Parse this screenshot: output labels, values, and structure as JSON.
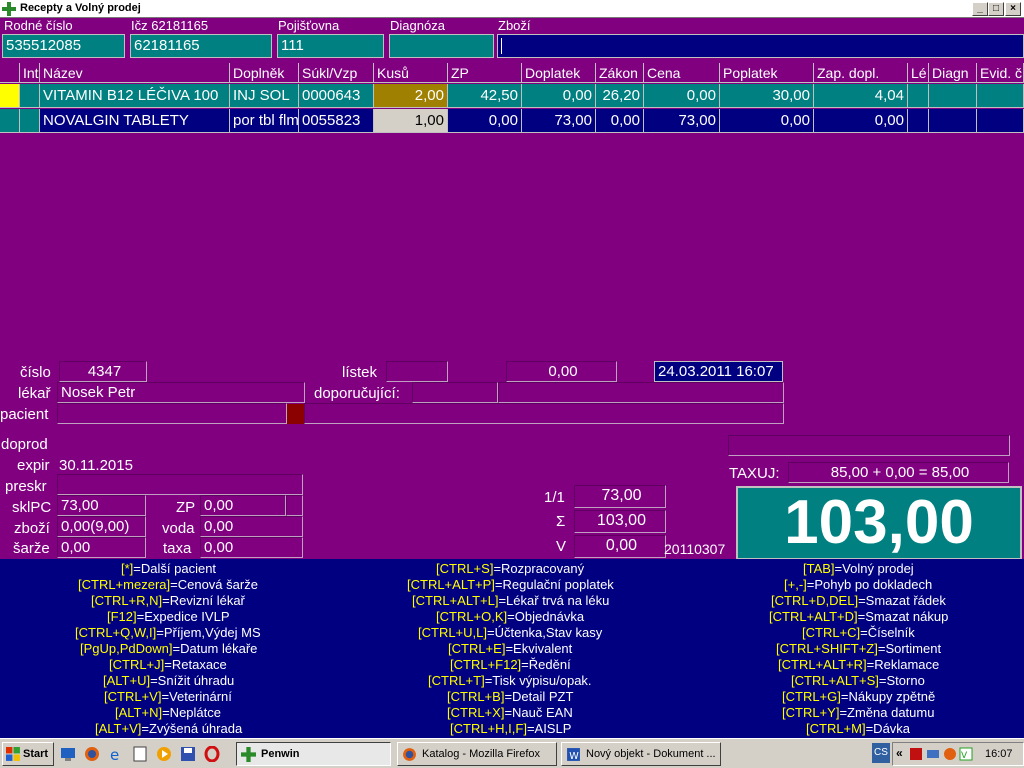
{
  "window": {
    "title": "Recepty a Volný prodej",
    "min": "_",
    "max": "□",
    "close": "×"
  },
  "header": {
    "rodne_cislo": {
      "label": "Rodné číslo",
      "value": "535512085"
    },
    "icz": {
      "label": "Ičz 62181165",
      "value": "62181165"
    },
    "pojistovna": {
      "label": "Pojišťovna",
      "value": "111"
    },
    "diagnoza": {
      "label": "Diagnóza",
      "value": ""
    },
    "zbozi": {
      "label": "Zboží",
      "value": ""
    }
  },
  "grid": {
    "columns": [
      "",
      "Int",
      "Název",
      "Doplněk",
      "Súkl/Vzp",
      "Kusů",
      "ZP",
      "Doplatek",
      "Zákon",
      "Cena",
      "Poplatek",
      "Zap. dopl.",
      "Lé",
      "Diagn",
      "Evid. č"
    ],
    "rows": [
      {
        "nazev": "VITAMIN B12 LÉČIVA 100",
        "doplnek": "INJ SOL",
        "sukl": "0000643",
        "kusu": "2,00",
        "zp": "42,50",
        "doplatek": "0,00",
        "zakon": "26,20",
        "cena": "0,00",
        "poplatek": "30,00",
        "zap": "4,04"
      },
      {
        "nazev": "NOVALGIN TABLETY",
        "doplnek": "por tbl flm",
        "sukl": "0055823",
        "kusu": "1,00",
        "zp": "0,00",
        "doplatek": "73,00",
        "zakon": "0,00",
        "cena": "73,00",
        "poplatek": "0,00",
        "zap": "0,00"
      }
    ]
  },
  "detail": {
    "cislo_label": "číslo",
    "cislo": "4347",
    "listek_label": "lístek",
    "listek": "",
    "amount": "0,00",
    "datetime": "24.03.2011 16:07",
    "lekar_label": "lékař",
    "lekar": "Nosek Petr",
    "doporucujici_label": "doporučující:",
    "pacient_label": "pacient",
    "doprod_label": "doprod",
    "expir_label": "expir",
    "expir": "30.11.2015",
    "preskr_label": "preskr",
    "sklpc_label": "sklPC",
    "sklpc": "73,00",
    "zp_label": "ZP",
    "zp": "0,00",
    "zbozi_label": "zboží",
    "zbozi": "0,00(9,00)",
    "voda_label": "voda",
    "voda": "0,00",
    "sarze_label": "šarže",
    "sarze": "0,00",
    "taxa_label": "taxa",
    "taxa": "0,00",
    "taxuj_label": "TAXUJ:",
    "taxuj": "85,00 + 0,00 = 85,00",
    "page_label": "1/1",
    "page_value": "73,00",
    "sum_label": "Σ",
    "sum_value": "103,00",
    "v_label": "V",
    "v_value": "0,00",
    "doc_no": "20110307",
    "total": "103,00"
  },
  "shortcuts": [
    {
      "key": "[*]",
      "text": "=Další pacient"
    },
    {
      "key": "[CTRL+mezera]",
      "text": "=Cenová šarže"
    },
    {
      "key": "[CTRL+R,N]",
      "text": "=Revizní lékař"
    },
    {
      "key": "[F12]",
      "text": "=Expedice IVLP"
    },
    {
      "key": "[CTRL+Q,W,I]",
      "text": "=Příjem,Výdej MS"
    },
    {
      "key": "[PgUp,PdDown]",
      "text": "=Datum lékaře"
    },
    {
      "key": "[CTRL+J]",
      "text": "=Retaxace"
    },
    {
      "key": "[ALT+U]",
      "text": "=Snížit úhradu"
    },
    {
      "key": "[CTRL+V]",
      "text": "=Veterinární"
    },
    {
      "key": "[ALT+N]",
      "text": "=Neplátce"
    },
    {
      "key": "[ALT+V]",
      "text": "=Zvýšená úhrada"
    },
    {
      "key": "[CTRL+S]",
      "text": "=Rozpracovaný"
    },
    {
      "key": "[CTRL+ALT+P]",
      "text": "=Regulační poplatek"
    },
    {
      "key": "[CTRL+ALT+L]",
      "text": "=Lékař trvá na léku"
    },
    {
      "key": "[CTRL+O,K]",
      "text": "=Objednávka"
    },
    {
      "key": "[CTRL+U,L]",
      "text": "=Účtenka,Stav kasy"
    },
    {
      "key": "[CTRL+E]",
      "text": "=Ekvivalent"
    },
    {
      "key": "[CTRL+F12]",
      "text": "=Ředění"
    },
    {
      "key": "[CTRL+T]",
      "text": "=Tisk výpisu/opak."
    },
    {
      "key": "[CTRL+B]",
      "text": "=Detail PZT"
    },
    {
      "key": "[CTRL+X]",
      "text": "=Nauč EAN"
    },
    {
      "key": "[CTRL+H,I,F]",
      "text": "=AISLP"
    },
    {
      "key": "[TAB]",
      "text": "=Volný prodej"
    },
    {
      "key": "[+,-]",
      "text": "=Pohyb po dokladech"
    },
    {
      "key": "[CTRL+D,DEL]",
      "text": "=Smazat řádek"
    },
    {
      "key": "[CTRL+ALT+D]",
      "text": "=Smazat nákup"
    },
    {
      "key": "[CTRL+C]",
      "text": "=Číselník"
    },
    {
      "key": "[CTRL+SHIFT+Z]",
      "text": "=Sortiment"
    },
    {
      "key": "[CTRL+ALT+R]",
      "text": "=Reklamace"
    },
    {
      "key": "[CTRL+ALT+S]",
      "text": "=Storno"
    },
    {
      "key": "[CTRL+G]",
      "text": "=Nákupy zpětně"
    },
    {
      "key": "[CTRL+Y]",
      "text": "=Změna datumu"
    },
    {
      "key": "[CTRL+M]",
      "text": "=Dávka"
    }
  ],
  "taskbar": {
    "start": "Start",
    "tasks": [
      "Penwin",
      "Katalog - Mozilla Firefox",
      "Nový objekt - Dokument ..."
    ],
    "tray_lang": "CS",
    "clock": "16:07"
  }
}
